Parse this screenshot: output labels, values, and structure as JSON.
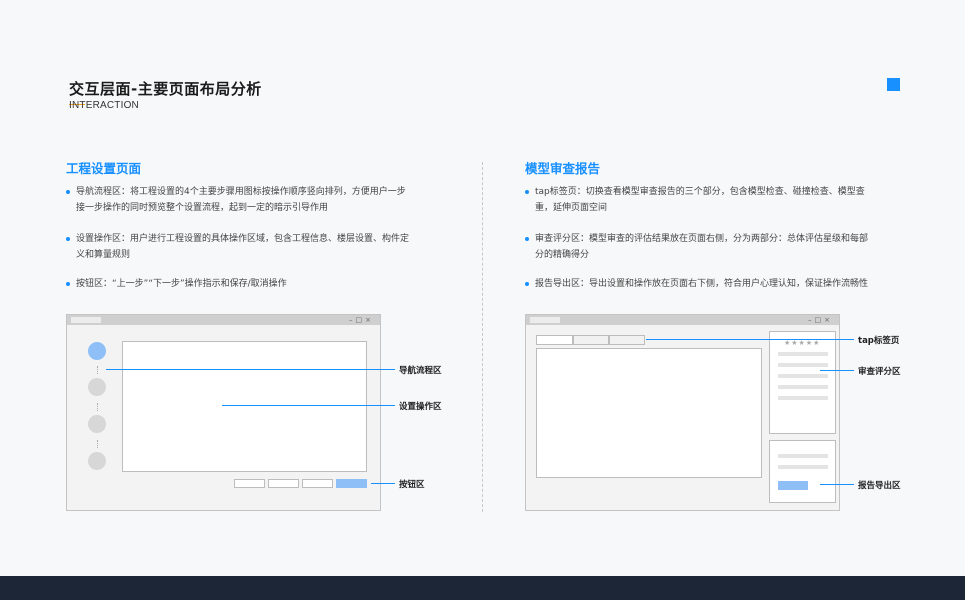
{
  "header": {
    "title": "交互层面-主要页面布局分析",
    "subtitle": "INTERACTION"
  },
  "left": {
    "title": "工程设置页面",
    "bullets": [
      "导航流程区：将工程设置的4个主要步骤用图标按操作顺序竖向排列，方便用户一步接一步操作的同时预览整个设置流程，起到一定的暗示引导作用",
      "设置操作区：用户进行工程设置的具体操作区域，包含工程信息、楼层设置、构件定义和算量规则",
      "按钮区：“上一步”“下一步”操作指示和保存/取消操作"
    ],
    "callouts": {
      "nav": "导航流程区",
      "settings": "设置操作区",
      "buttons": "按钮区"
    }
  },
  "right": {
    "title": "模型审查报告",
    "bullets": [
      "tap标签页：切换查看模型审查报告的三个部分，包含模型检查、碰撞检查、模型查重，延伸页面空间",
      "审查评分区：模型审查的评估结果放在页面右侧，分为两部分：总体评估星级和每部分的精确得分",
      "报告导出区：导出设置和操作放在页面右下侧，符合用户心理认知，保证操作流畅性"
    ],
    "callouts": {
      "tabs": "tap标签页",
      "score": "审查评分区",
      "export": "报告导出区"
    },
    "stars": "★★★★★"
  },
  "window": {
    "controls": "–□×"
  },
  "colors": {
    "accent": "#1890ff",
    "highlight": "#8ec0f7",
    "underline": "#f5a623",
    "footer": "#1c2637"
  }
}
